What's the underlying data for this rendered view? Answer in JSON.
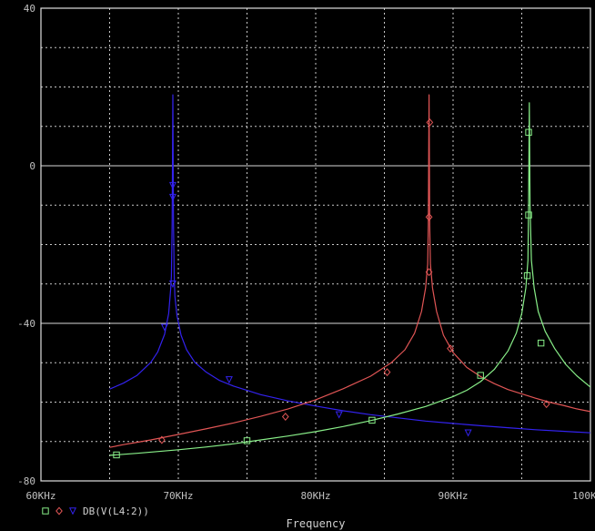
{
  "chart_data": {
    "type": "line",
    "xlabel": "Frequency",
    "ylabel": "",
    "x_scale": "linear",
    "xlim": [
      60000,
      100000
    ],
    "ylim": [
      -80,
      40
    ],
    "x_ticks": [
      {
        "value": 60000,
        "label": "60KHz"
      },
      {
        "value": 70000,
        "label": "70KHz"
      },
      {
        "value": 80000,
        "label": "80KHz"
      },
      {
        "value": 90000,
        "label": "90KHz"
      },
      {
        "value": 100000,
        "label": "100KHz"
      }
    ],
    "y_ticks": [
      {
        "value": 40,
        "label": "40"
      },
      {
        "value": 0,
        "label": "0"
      },
      {
        "value": -40,
        "label": "-40"
      },
      {
        "value": -80,
        "label": "-80"
      }
    ],
    "grid": "dashed",
    "legend": {
      "placement": "bottom-left",
      "markers": [
        "square",
        "diamond",
        "triangle-down"
      ],
      "text": "DB(V(L4:2))"
    },
    "series": [
      {
        "color": "#3322ee",
        "marker": "triangle-down",
        "points": [
          [
            65000,
            -56.7
          ],
          [
            66000,
            -55.2
          ],
          [
            67000,
            -53.2
          ],
          [
            68000,
            -49.9
          ],
          [
            68500,
            -47.3
          ],
          [
            69000,
            -42.8
          ],
          [
            69300,
            -37.5
          ],
          [
            69450,
            -31
          ],
          [
            69500,
            -28
          ],
          [
            69550,
            -15
          ],
          [
            69600,
            18
          ],
          [
            69650,
            -15
          ],
          [
            69700,
            -28
          ],
          [
            69750,
            -33
          ],
          [
            69900,
            -38
          ],
          [
            70200,
            -43
          ],
          [
            70600,
            -46.7
          ],
          [
            71200,
            -49.9
          ],
          [
            72000,
            -52.3
          ],
          [
            73000,
            -54.5
          ],
          [
            74000,
            -55.9
          ],
          [
            76000,
            -58.1
          ],
          [
            78000,
            -59.7
          ],
          [
            80000,
            -61
          ],
          [
            82000,
            -62.2
          ],
          [
            84000,
            -63.2
          ],
          [
            86000,
            -64
          ],
          [
            88000,
            -64.8
          ],
          [
            90000,
            -65.4
          ],
          [
            92000,
            -66
          ],
          [
            94000,
            -66.5
          ],
          [
            96000,
            -67
          ],
          [
            98000,
            -67.4
          ],
          [
            100000,
            -67.8
          ]
        ],
        "marker_points": [
          [
            69600,
            -5
          ],
          [
            69600,
            -8
          ],
          [
            69600,
            -30
          ],
          [
            69000,
            -41
          ],
          [
            73700,
            -54.3
          ],
          [
            81700,
            -63.2
          ],
          [
            91100,
            -67.8
          ]
        ]
      },
      {
        "color": "#e05555",
        "marker": "diamond",
        "points": [
          [
            65000,
            -71.5
          ],
          [
            66000,
            -70.8
          ],
          [
            67000,
            -70.2
          ],
          [
            68000,
            -69.6
          ],
          [
            70000,
            -68.2
          ],
          [
            72000,
            -66.8
          ],
          [
            74000,
            -65.3
          ],
          [
            76000,
            -63.6
          ],
          [
            78000,
            -61.7
          ],
          [
            80000,
            -59.4
          ],
          [
            82000,
            -56.6
          ],
          [
            84000,
            -53.4
          ],
          [
            85500,
            -50
          ],
          [
            86500,
            -46.7
          ],
          [
            87200,
            -42.5
          ],
          [
            87700,
            -37
          ],
          [
            88000,
            -31
          ],
          [
            88150,
            -25
          ],
          [
            88200,
            -15
          ],
          [
            88250,
            18
          ],
          [
            88300,
            -15
          ],
          [
            88350,
            -25
          ],
          [
            88500,
            -31
          ],
          [
            88800,
            -37
          ],
          [
            89300,
            -43
          ],
          [
            90000,
            -47.4
          ],
          [
            91000,
            -51.2
          ],
          [
            92000,
            -53.5
          ],
          [
            93000,
            -55.3
          ],
          [
            94000,
            -56.8
          ],
          [
            95000,
            -57.9
          ],
          [
            96000,
            -59
          ],
          [
            97000,
            -60
          ],
          [
            98000,
            -60.8
          ],
          [
            99000,
            -61.7
          ],
          [
            100000,
            -62.4
          ]
        ],
        "marker_points": [
          [
            68800,
            -69.6
          ],
          [
            77800,
            -63.7
          ],
          [
            85200,
            -52.4
          ],
          [
            88250,
            -27
          ],
          [
            88250,
            -13
          ],
          [
            88300,
            11
          ],
          [
            89800,
            -46.4
          ],
          [
            96800,
            -60.5
          ]
        ]
      },
      {
        "color": "#88ee88",
        "marker": "square",
        "points": [
          [
            65000,
            -73.5
          ],
          [
            67000,
            -73
          ],
          [
            70000,
            -72.1
          ],
          [
            72000,
            -71.4
          ],
          [
            74000,
            -70.6
          ],
          [
            76000,
            -69.6
          ],
          [
            78000,
            -68.6
          ],
          [
            80000,
            -67.5
          ],
          [
            82000,
            -66.2
          ],
          [
            84000,
            -64.7
          ],
          [
            86000,
            -63
          ],
          [
            88000,
            -61.1
          ],
          [
            90000,
            -58.6
          ],
          [
            91000,
            -57
          ],
          [
            92000,
            -54.8
          ],
          [
            93000,
            -51.7
          ],
          [
            94000,
            -47
          ],
          [
            94600,
            -42.5
          ],
          [
            95000,
            -37.5
          ],
          [
            95300,
            -31
          ],
          [
            95450,
            -24
          ],
          [
            95500,
            -10
          ],
          [
            95550,
            16
          ],
          [
            95600,
            -10
          ],
          [
            95700,
            -24
          ],
          [
            95900,
            -31
          ],
          [
            96200,
            -37
          ],
          [
            96700,
            -42
          ],
          [
            97400,
            -46.4
          ],
          [
            98200,
            -50.4
          ],
          [
            99000,
            -53.3
          ],
          [
            100000,
            -56.2
          ]
        ],
        "marker_points": [
          [
            65500,
            -73.4
          ],
          [
            75000,
            -69.8
          ],
          [
            84100,
            -64.6
          ],
          [
            92000,
            -53.2
          ],
          [
            95400,
            -27.9
          ],
          [
            95500,
            -12.5
          ],
          [
            95500,
            8.5
          ],
          [
            96400,
            -45
          ]
        ]
      }
    ]
  }
}
